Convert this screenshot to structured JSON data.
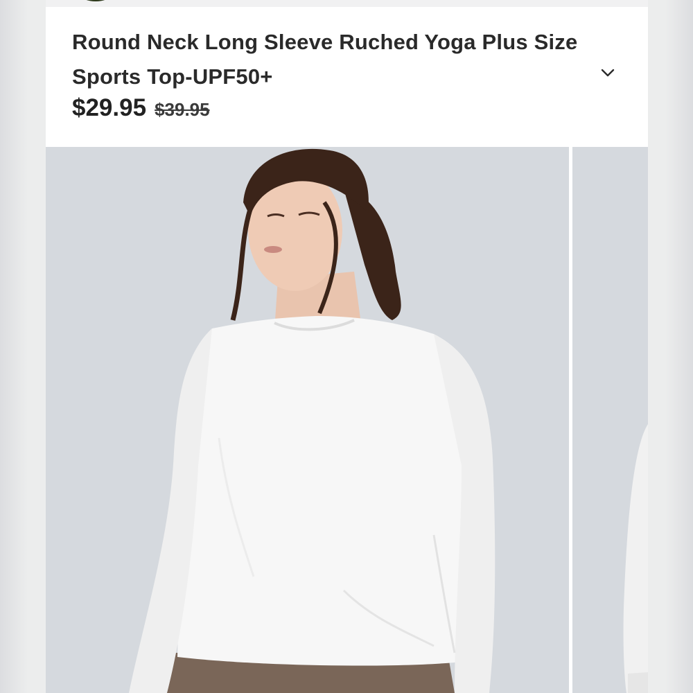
{
  "product": {
    "title": "Round Neck Long Sleeve Ruched Yoga Plus Size Sports Top-UPF50+",
    "price_current": "$29.95",
    "price_original": "$39.95"
  },
  "icons": {
    "expand": "chevron-down-icon"
  },
  "colors": {
    "photo_background": "#d5d9de",
    "top_color": "#f7f7f7",
    "pants_color": "#7a6658",
    "text": "#2a2a2a"
  }
}
